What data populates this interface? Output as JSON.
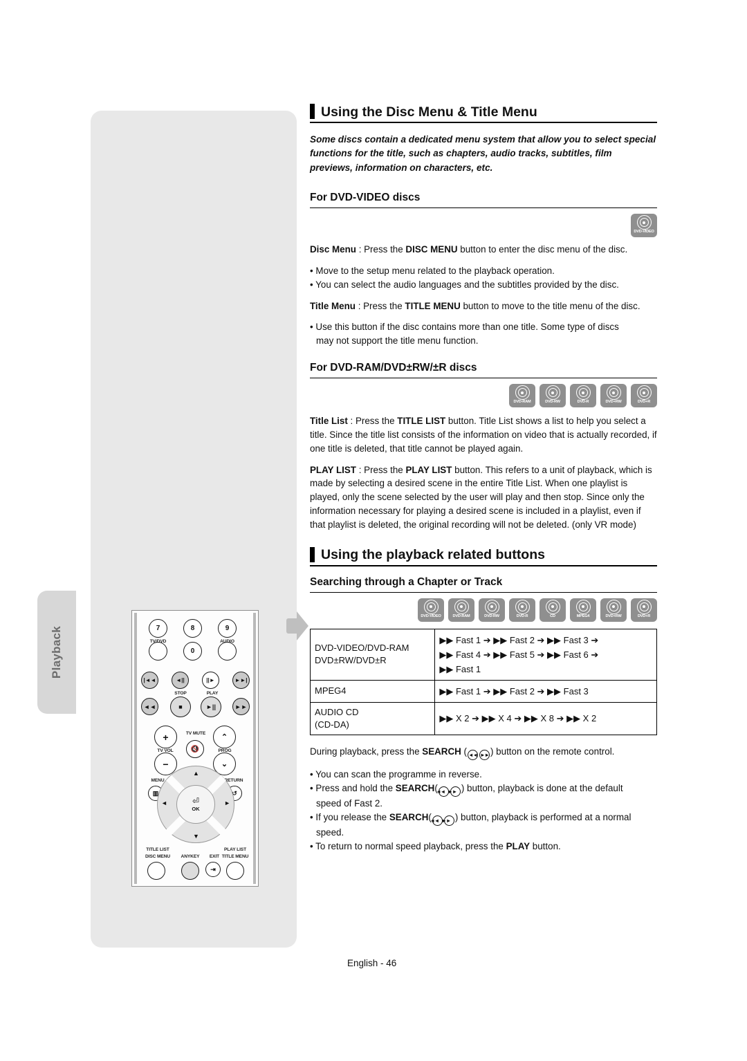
{
  "sidebar": {
    "tab_label": "Playback"
  },
  "page": {
    "footer": "English - 46"
  },
  "sections": {
    "disc_menu": {
      "heading": "Using the Disc Menu & Title Menu",
      "intro": "Some discs contain a dedicated menu system that allow you to select special functions for the title, such as chapters, audio tracks, subtitles, film previews, information on characters, etc.",
      "sub_dvd_video": "For DVD-VIDEO discs",
      "badge_dvd_video": "DVD-VIDEO",
      "disc_menu_para_label": "Disc Menu",
      "disc_menu_para_sep": " : Press the ",
      "disc_menu_para_btn": "DISC MENU",
      "disc_menu_para_rest": " button to enter the disc menu of the disc.",
      "bullet_1": "• Move to the setup menu related to the playback operation.",
      "bullet_2": "• You can select the audio languages and the subtitles provided by the disc.",
      "title_menu_label": "Title Menu",
      "title_menu_sep": " : Press the ",
      "title_menu_btn": "TITLE MENU",
      "title_menu_rest": " button to move to the title menu of the disc.",
      "bullet_3": "• Use this button if the disc contains more than one title. Some type of discs",
      "bullet_3_cont": "may not support the title menu function.",
      "sub_dvd_ram": "For DVD-RAM/DVD±RW/±R discs",
      "title_list_label": "Title List",
      "title_list_sep": " : Press the ",
      "title_list_btn": "TITLE LIST",
      "title_list_rest": " button. Title List shows a list to help you select a title. Since the title list consists of the information on video that is actually recorded, if one title is deleted, that title cannot be played again.",
      "play_list_label": "PLAY LIST",
      "play_list_sep": " : Press the ",
      "play_list_btn": "PLAY LIST",
      "play_list_rest": " button. This refers to a unit of playback, which is made by selecting a desired scene in the entire Title List. When one playlist is played, only the scene selected by the user will play and then stop. Since only the information necessary for playing a desired scene is included in a playlist, even if that playlist is deleted, the original recording will not be deleted. (only VR mode)"
    },
    "playback_buttons": {
      "heading": "Using the playback related buttons",
      "sub_search": "Searching through a Chapter or Track",
      "intro_pre": "During playback, press the ",
      "intro_btn": "SEARCH",
      "intro_post": ") button on the remote control.",
      "bullet_1": "• You can scan the programme in reverse.",
      "b2_pre": "• Press and hold the ",
      "b2_btn": "SEARCH",
      "b2_post": ") button, playback is done at the default",
      "b2_cont": "speed of Fast 2.",
      "b3_pre": "• If you release the ",
      "b3_btn": "SEARCH",
      "b3_post": ") button, playback is performed at a normal",
      "b3_cont": "speed.",
      "b4_pre": "• To return to normal speed playback, press the ",
      "b4_btn": "PLAY",
      "b4_post": " button."
    }
  },
  "badges_ram": [
    "DVD-RAM",
    "DVD-RW",
    "DVD-R",
    "DVD+RW",
    "DVD+R"
  ],
  "badges_search": [
    "DVD-VIDEO",
    "DVD-RAM",
    "DVD-RW",
    "DVD-R",
    "CD",
    "MPEG4",
    "DVD+RW",
    "DVD+R"
  ],
  "speed_table": {
    "rows": [
      {
        "label_line1": "DVD-VIDEO/DVD-RAM",
        "label_line2": "DVD±RW/DVD±R",
        "value_line1": "▶▶ Fast 1 ➔ ▶▶ Fast 2 ➔ ▶▶ Fast 3 ➔",
        "value_line2": "▶▶ Fast 4 ➔ ▶▶ Fast 5 ➔ ▶▶ Fast 6 ➔",
        "value_line3": "▶▶ Fast 1"
      },
      {
        "label_line1": "MPEG4",
        "label_line2": "",
        "value_line1": "▶▶ Fast 1 ➔ ▶▶ Fast 2 ➔ ▶▶ Fast 3",
        "value_line2": "",
        "value_line3": ""
      },
      {
        "label_line1": "AUDIO CD",
        "label_line2": "(CD-DA)",
        "value_line1": "▶▶ X 2 ➔ ▶▶ X 4 ➔ ▶▶ X 8 ➔ ▶▶ X 2",
        "value_line2": "",
        "value_line3": ""
      }
    ]
  },
  "remote": {
    "keys": {
      "n7": "7",
      "n8": "8",
      "n9": "9",
      "n0": "0",
      "tvdvd": "TV/DVD",
      "audio": "AUDIO",
      "stop": "STOP",
      "play": "PLAY",
      "tvvol": "TV VOL",
      "tvmute": "TV MUTE",
      "prog": "PROG",
      "plus": "+",
      "minus": "−",
      "menu": "MENU",
      "return": "RETURN",
      "ok": "OK",
      "title_list": "TITLE LIST",
      "disc_menu": "DISC MENU",
      "anykey": "ANYKEY",
      "exit": "EXIT",
      "play_list": "PLAY LIST",
      "title_menu": "TITLE MENU"
    }
  }
}
